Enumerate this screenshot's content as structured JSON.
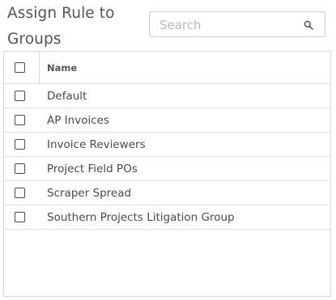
{
  "dialog": {
    "title": "Assign Rule to Groups"
  },
  "search": {
    "placeholder": "Search",
    "value": "",
    "icon": "search-icon"
  },
  "table": {
    "columns": [
      "Name"
    ],
    "rows": [
      {
        "name": "Default",
        "checked": false
      },
      {
        "name": "AP Invoices",
        "checked": false
      },
      {
        "name": "Invoice Reviewers",
        "checked": false
      },
      {
        "name": "Project Field POs",
        "checked": false
      },
      {
        "name": "Scraper Spread",
        "checked": false
      },
      {
        "name": "Southern Projects Litigation Group",
        "checked": false
      }
    ]
  },
  "colors": {
    "border": "#d9d9d9",
    "text": "#4a4a4a",
    "placeholder": "#bbbbbb"
  }
}
